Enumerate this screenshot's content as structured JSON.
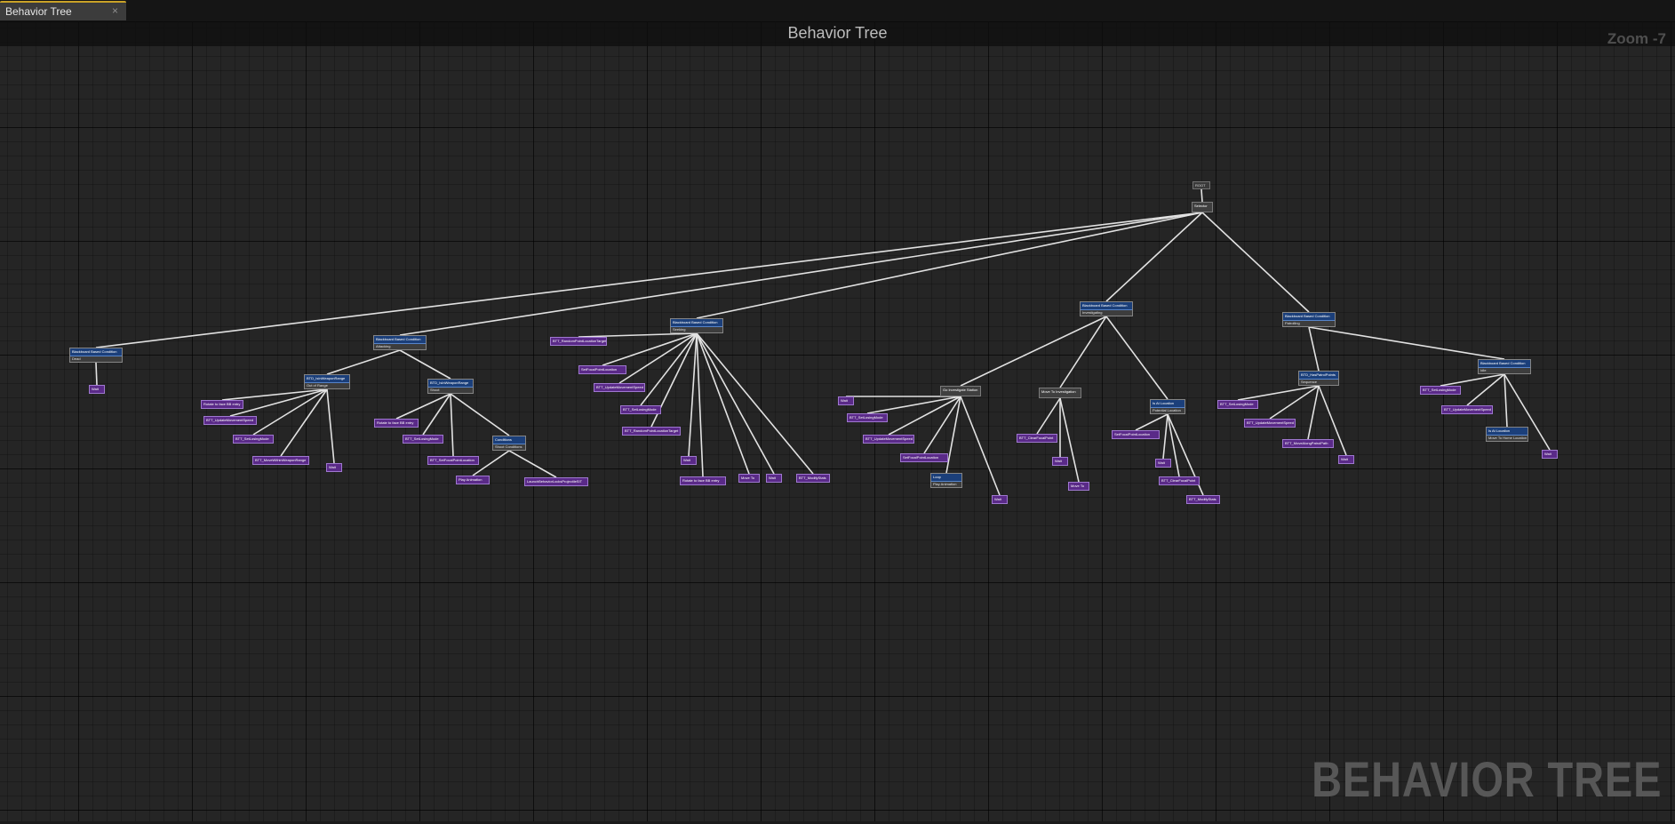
{
  "tab": {
    "label": "Behavior Tree",
    "close_glyph": "×"
  },
  "graph": {
    "title": "Behavior Tree",
    "zoom": "Zoom -7",
    "watermark": "BEHAVIOR TREE"
  },
  "nodes": [
    {
      "id": "root",
      "kind": "root",
      "label": "ROOT"
    },
    {
      "id": "selector",
      "kind": "comp",
      "label": "Selector"
    },
    {
      "id": "dead",
      "kind": "dec",
      "label": "Blackboard Based Condition",
      "sub": "Dead"
    },
    {
      "id": "dead_wait",
      "kind": "task",
      "label": "Wait"
    },
    {
      "id": "attacking",
      "kind": "dec",
      "label": "Blackboard Based Condition",
      "sub": "Attacking"
    },
    {
      "id": "out_range",
      "kind": "dec",
      "label": "BTD_IsInWeaponRange",
      "sub": "Out of Range"
    },
    {
      "id": "or_t1",
      "kind": "task",
      "label": "Rotate to face BB entry"
    },
    {
      "id": "or_t2",
      "kind": "task",
      "label": "BTT_UpdateMovementSpeed"
    },
    {
      "id": "or_t3",
      "kind": "task",
      "label": "BTT_SetLosingMode"
    },
    {
      "id": "or_t4",
      "kind": "task",
      "label": "BTT_MoveWithinWeaponRange"
    },
    {
      "id": "or_t5",
      "kind": "task",
      "label": "Wait"
    },
    {
      "id": "shoot",
      "kind": "dec",
      "label": "BTD_IsInWeaponRange",
      "sub": "Shoot"
    },
    {
      "id": "sh_t1",
      "kind": "task",
      "label": "Rotate to face BB entry"
    },
    {
      "id": "sh_t2",
      "kind": "task",
      "label": "BTT_SetLosingMode"
    },
    {
      "id": "sh_t3",
      "kind": "task",
      "label": "BTT_SetFocalPointLocation"
    },
    {
      "id": "shoot_cond",
      "kind": "dec",
      "label": "Conditions",
      "sub": "Shoot Conditions"
    },
    {
      "id": "sc_t1",
      "kind": "task",
      "label": "Play Animation"
    },
    {
      "id": "sc_t2",
      "kind": "task",
      "label": "LaunchBehaviorLocksProjectileSIT"
    },
    {
      "id": "seeking",
      "kind": "dec",
      "label": "Blackboard Based Condition",
      "sub": "Seeking"
    },
    {
      "id": "sk_t1",
      "kind": "task",
      "label": "BTT_RandomPointLocationTarget"
    },
    {
      "id": "sk_t2",
      "kind": "task",
      "label": "SetFocalPointLocation"
    },
    {
      "id": "sk_t3",
      "kind": "task",
      "label": "BTT_UpdateMovementSpeed"
    },
    {
      "id": "sk_t4",
      "kind": "task",
      "label": "BTT_SetLosingMode"
    },
    {
      "id": "sk_t5",
      "kind": "task",
      "label": "BTT_RandomPointLocationTarget"
    },
    {
      "id": "sk_t6",
      "kind": "task",
      "label": "Wait"
    },
    {
      "id": "sk_t7",
      "kind": "task",
      "label": "Rotate to face BB entry"
    },
    {
      "id": "sk_t8",
      "kind": "task",
      "label": "Move To"
    },
    {
      "id": "sk_t9",
      "kind": "task",
      "label": "Wait"
    },
    {
      "id": "sk_t10",
      "kind": "task",
      "label": "BTT_ModifyStats"
    },
    {
      "id": "investigating",
      "kind": "dec",
      "label": "Blackboard Based Condition",
      "sub": "Investigating"
    },
    {
      "id": "go_investigate",
      "kind": "comp",
      "label": "Go Investigate Station"
    },
    {
      "id": "gi_t1",
      "kind": "task",
      "label": "Wait"
    },
    {
      "id": "gi_t2",
      "kind": "task",
      "label": "BTT_SetLosingMode"
    },
    {
      "id": "gi_t3",
      "kind": "task",
      "label": "BTT_UpdateMovementSpeed"
    },
    {
      "id": "gi_t4",
      "kind": "task",
      "label": "SetFocalPointLocation"
    },
    {
      "id": "gi_loop",
      "kind": "dec",
      "label": "Loop",
      "sub": "Play Animation"
    },
    {
      "id": "gi_t6",
      "kind": "task",
      "label": "Wait"
    },
    {
      "id": "move_invest",
      "kind": "comp",
      "label": "Move To Investigation"
    },
    {
      "id": "mi_t1",
      "kind": "task",
      "label": "BTT_ClearFocalPoint"
    },
    {
      "id": "mi_t2",
      "kind": "task",
      "label": "Wait"
    },
    {
      "id": "mi_t3",
      "kind": "task",
      "label": "Move To"
    },
    {
      "id": "is_location",
      "kind": "dec",
      "label": "Is At Location",
      "sub": "Potential Location"
    },
    {
      "id": "il_t1",
      "kind": "task",
      "label": "SetFocalPointLocation"
    },
    {
      "id": "il_t2",
      "kind": "task",
      "label": "Wait"
    },
    {
      "id": "il_t3",
      "kind": "task",
      "label": "BTT_ClearFocalPoint"
    },
    {
      "id": "il_t4",
      "kind": "task",
      "label": "BTT_ModifyStats"
    },
    {
      "id": "patrolling",
      "kind": "dec",
      "label": "Blackboard Based Condition",
      "sub": "Patrolling"
    },
    {
      "id": "patrol_seq",
      "kind": "dec",
      "label": "BTD_HasPatrolPoints",
      "sub": "Sequence"
    },
    {
      "id": "ps_t1",
      "kind": "task",
      "label": "BTT_SetLosingMode"
    },
    {
      "id": "ps_t2",
      "kind": "task",
      "label": "BTT_UpdateMovementSpeed"
    },
    {
      "id": "ps_t3",
      "kind": "task",
      "label": "BTT_MoveAlongPatrolPath"
    },
    {
      "id": "ps_t4",
      "kind": "task",
      "label": "Wait"
    },
    {
      "id": "idle",
      "kind": "dec",
      "label": "Blackboard Based Condition",
      "sub": "Idle"
    },
    {
      "id": "id_t1",
      "kind": "task",
      "label": "BTT_SetLosingMode"
    },
    {
      "id": "id_t2",
      "kind": "task",
      "label": "BTT_UpdateMovementSpeed"
    },
    {
      "id": "id_home",
      "kind": "dec",
      "label": "Is At Location",
      "sub": "Move To Home Location"
    },
    {
      "id": "id_t4",
      "kind": "task",
      "label": "Wait"
    }
  ]
}
